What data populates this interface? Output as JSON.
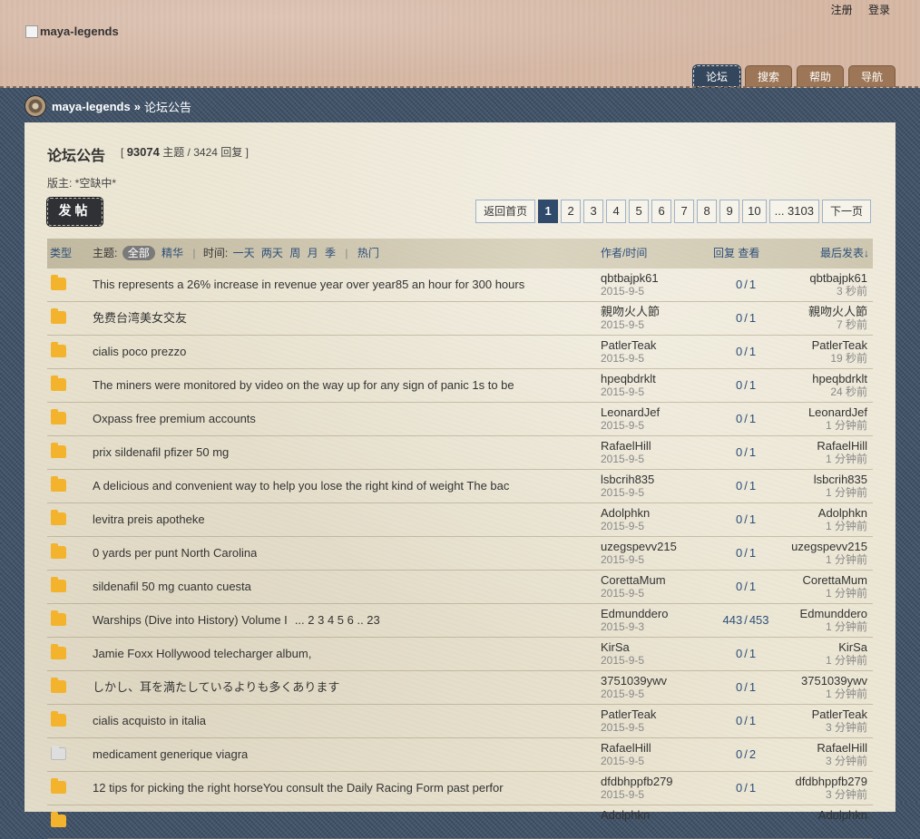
{
  "header": {
    "register": "注册",
    "login": "登录",
    "logo_alt": "maya-legends",
    "nav": [
      "论坛",
      "搜索",
      "帮助",
      "导航"
    ]
  },
  "breadcrumb": {
    "home": "maya-legends",
    "sep": "»",
    "current": "论坛公告"
  },
  "forum": {
    "title": "论坛公告",
    "stats_open": "[",
    "topics_count": "93074",
    "topics_label": "主题",
    "slash": "/",
    "replies_text": "3424 回复",
    "stats_close": "]",
    "moderator": "版主: *空缺中*",
    "post_button": "发帖"
  },
  "pager": {
    "back": "返回首页",
    "pages": [
      "1",
      "2",
      "3",
      "4",
      "5",
      "6",
      "7",
      "8",
      "9",
      "10"
    ],
    "last": "... 3103",
    "next": "下一页"
  },
  "table_header": {
    "type": "类型",
    "subject_label": "主题:",
    "all": "全部",
    "digest": "精华",
    "time_label": "时间:",
    "times": [
      "一天",
      "两天",
      "周",
      "月",
      "季"
    ],
    "hot": "热门",
    "author_time": "作者/时间",
    "reply_view": "回复 查看",
    "last_post": "最后发表↓"
  },
  "rows": [
    {
      "title": "This represents a 26% increase in revenue year over year85 an hour for 300 hours",
      "author": "qbtbajpk61",
      "date": "2015-9-5",
      "replies": "0",
      "views": "1",
      "last_user": "qbtbajpk61",
      "last_time": "3 秒前",
      "icon": "folder-new"
    },
    {
      "title": "免费台湾美女交友",
      "author": "親吻火人節",
      "date": "2015-9-5",
      "replies": "0",
      "views": "1",
      "last_user": "親吻火人節",
      "last_time": "7 秒前",
      "icon": "folder-new"
    },
    {
      "title": "cialis poco prezzo",
      "author": "PatlerTeak",
      "date": "2015-9-5",
      "replies": "0",
      "views": "1",
      "last_user": "PatlerTeak",
      "last_time": "19 秒前",
      "icon": "folder-new"
    },
    {
      "title": "The miners were monitored by video on the way up for any sign of panic 1s to be",
      "author": "hpeqbdrklt",
      "date": "2015-9-5",
      "replies": "0",
      "views": "1",
      "last_user": "hpeqbdrklt",
      "last_time": "24 秒前",
      "icon": "folder-new"
    },
    {
      "title": "Oxpass free premium accounts",
      "author": "LeonardJef",
      "date": "2015-9-5",
      "replies": "0",
      "views": "1",
      "last_user": "LeonardJef",
      "last_time": "1 分钟前",
      "icon": "folder-new"
    },
    {
      "title": "prix sildenafil pfizer 50 mg",
      "author": "RafaelHill",
      "date": "2015-9-5",
      "replies": "0",
      "views": "1",
      "last_user": "RafaelHill",
      "last_time": "1 分钟前",
      "icon": "folder-new"
    },
    {
      "title": "A delicious and convenient way to help you lose the right kind of weight The bac",
      "author": "lsbcrih835",
      "date": "2015-9-5",
      "replies": "0",
      "views": "1",
      "last_user": "lsbcrih835",
      "last_time": "1 分钟前",
      "icon": "folder-new"
    },
    {
      "title": "levitra preis apotheke",
      "author": "Adolphkn",
      "date": "2015-9-5",
      "replies": "0",
      "views": "1",
      "last_user": "Adolphkn",
      "last_time": "1 分钟前",
      "icon": "folder-new"
    },
    {
      "title": "0 yards per punt North Carolina",
      "author": "uzegspevv215",
      "date": "2015-9-5",
      "replies": "0",
      "views": "1",
      "last_user": "uzegspevv215",
      "last_time": "1 分钟前",
      "icon": "folder-new"
    },
    {
      "title": "sildenafil 50 mg cuanto cuesta",
      "author": "CorettaMum",
      "date": "2015-9-5",
      "replies": "0",
      "views": "1",
      "last_user": "CorettaMum",
      "last_time": "1 分钟前",
      "icon": "folder-new"
    },
    {
      "title": "Warships (Dive into History) Volume I",
      "pages": "... 2  3  4  5  6 .. 23",
      "author": "Edmunddero",
      "date": "2015-9-3",
      "replies": "443",
      "views": "453",
      "last_user": "Edmunddero",
      "last_time": "1 分钟前",
      "icon": "folder-new"
    },
    {
      "title": "Jamie Foxx Hollywood telecharger album,",
      "author": "KirSa",
      "date": "2015-9-5",
      "replies": "0",
      "views": "1",
      "last_user": "KirSa",
      "last_time": "1 分钟前",
      "icon": "folder-new"
    },
    {
      "title": "しかし、耳を満たしているよりも多くあります",
      "author": "3751039ywv",
      "date": "2015-9-5",
      "replies": "0",
      "views": "1",
      "last_user": "3751039ywv",
      "last_time": "1 分钟前",
      "icon": "folder-new"
    },
    {
      "title": "cialis acquisto in italia",
      "author": "PatlerTeak",
      "date": "2015-9-5",
      "replies": "0",
      "views": "1",
      "last_user": "PatlerTeak",
      "last_time": "3 分钟前",
      "icon": "folder-new"
    },
    {
      "title": "medicament generique viagra",
      "author": "RafaelHill",
      "date": "2015-9-5",
      "replies": "0",
      "views": "2",
      "last_user": "RafaelHill",
      "last_time": "3 分钟前",
      "icon": "folder-read"
    },
    {
      "title": "12 tips for picking the right horseYou consult the Daily Racing Form past perfor",
      "author": "dfdbhppfb279",
      "date": "2015-9-5",
      "replies": "0",
      "views": "1",
      "last_user": "dfdbhppfb279",
      "last_time": "3 分钟前",
      "icon": "folder-new"
    },
    {
      "title": "",
      "author": "Adolphkn",
      "date": "",
      "replies": "",
      "views": "",
      "last_user": "Adolphkn",
      "last_time": "",
      "icon": "folder-new"
    }
  ]
}
